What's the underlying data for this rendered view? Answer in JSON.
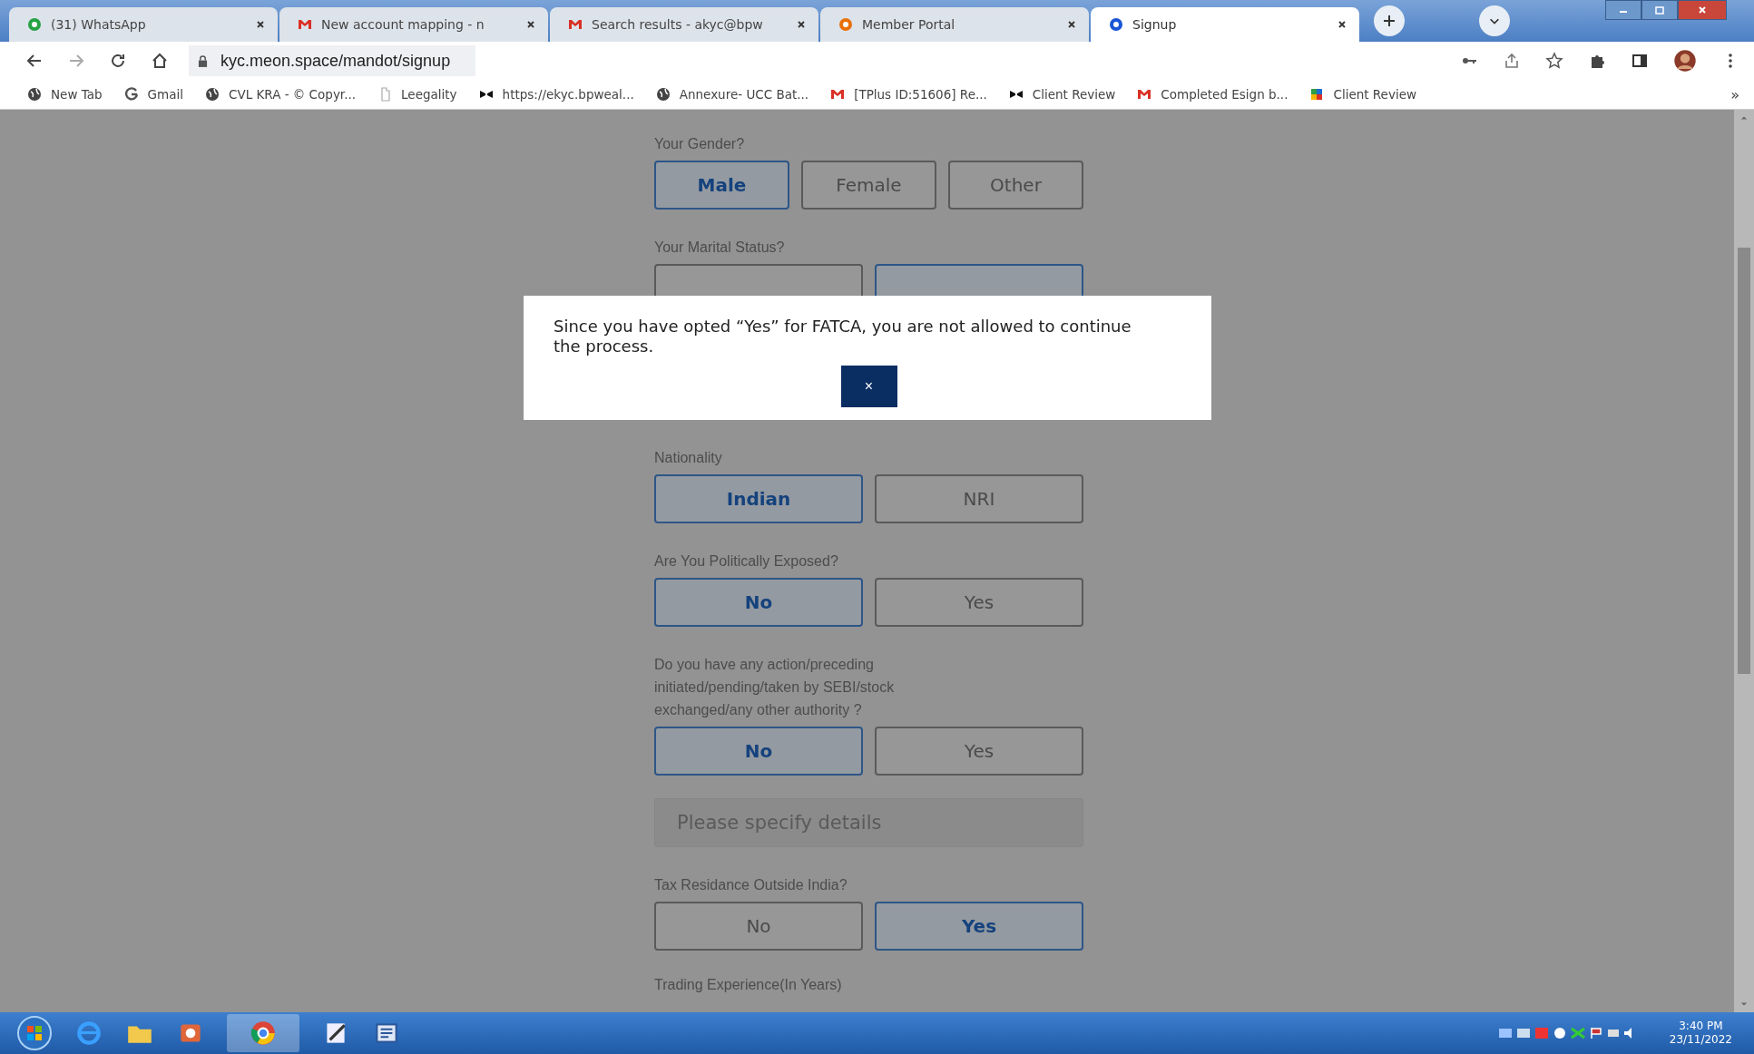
{
  "browser": {
    "tabs": [
      {
        "title": "(31) WhatsApp",
        "kind": "whatsapp",
        "selected": false
      },
      {
        "title": "New account mapping - n",
        "kind": "gmail",
        "selected": false
      },
      {
        "title": "Search results - akyc@bpw",
        "kind": "gmail",
        "selected": false
      },
      {
        "title": "Member Portal",
        "kind": "portal",
        "selected": false
      },
      {
        "title": "Signup",
        "kind": "signup",
        "selected": true
      }
    ],
    "url": "kyc.meon.space/mandot/signup",
    "bookmarks": [
      {
        "label": "New Tab",
        "kind": "globe"
      },
      {
        "label": "Gmail",
        "kind": "google"
      },
      {
        "label": "CVL KRA - © Copyr...",
        "kind": "globe"
      },
      {
        "label": "Leegality",
        "kind": "doc"
      },
      {
        "label": "https://ekyc.bpweal...",
        "kind": "bowtie"
      },
      {
        "label": "Annexure- UCC Bat...",
        "kind": "globe"
      },
      {
        "label": "[TPlus ID:51606] Re...",
        "kind": "gmail"
      },
      {
        "label": "Client Review",
        "kind": "bowtie"
      },
      {
        "label": "Completed Esign b...",
        "kind": "gmail"
      },
      {
        "label": "Client Review",
        "kind": "sheet"
      }
    ],
    "more": "»"
  },
  "form": [
    {
      "kind": "choice",
      "label": "Your Gender?",
      "options": [
        {
          "label": "Male",
          "selected": true
        },
        {
          "label": "Female",
          "selected": false
        },
        {
          "label": "Other",
          "selected": false
        }
      ]
    },
    {
      "kind": "choice",
      "label": "Your Marital Status?",
      "options": [
        {
          "selected": false
        },
        {
          "selected": true
        }
      ]
    },
    {
      "kind": "hidden"
    },
    {
      "kind": "choice",
      "label": "Nationality",
      "options": [
        {
          "label": "Indian",
          "selected": true
        },
        {
          "label": "NRI",
          "selected": false
        }
      ]
    },
    {
      "kind": "choice",
      "label": "Are You Politically Exposed?",
      "options": [
        {
          "label": "No",
          "selected": true
        },
        {
          "label": "Yes",
          "selected": false
        }
      ]
    },
    {
      "kind": "choice",
      "label": "Do you have any action/preceding initiated/pending/taken by SEBI/stock exchanged/any other authority ?",
      "options": [
        {
          "label": "No",
          "selected": true
        },
        {
          "label": "Yes",
          "selected": false
        }
      ]
    },
    {
      "kind": "input",
      "placeholder": "Please specify details"
    },
    {
      "kind": "choice",
      "label": "Tax Residance Outside India?",
      "options": [
        {
          "label": "No",
          "selected": false
        },
        {
          "label": "Yes",
          "selected": true
        }
      ]
    },
    {
      "kind": "heading",
      "label": "Trading Experience(In Years)"
    }
  ],
  "modal": {
    "message": "Since you have opted “Yes” for FATCA, you are not allowed to continue the process.",
    "close": "×"
  },
  "taskbar": {
    "time": "3:40 PM",
    "date": "23/11/2022"
  }
}
